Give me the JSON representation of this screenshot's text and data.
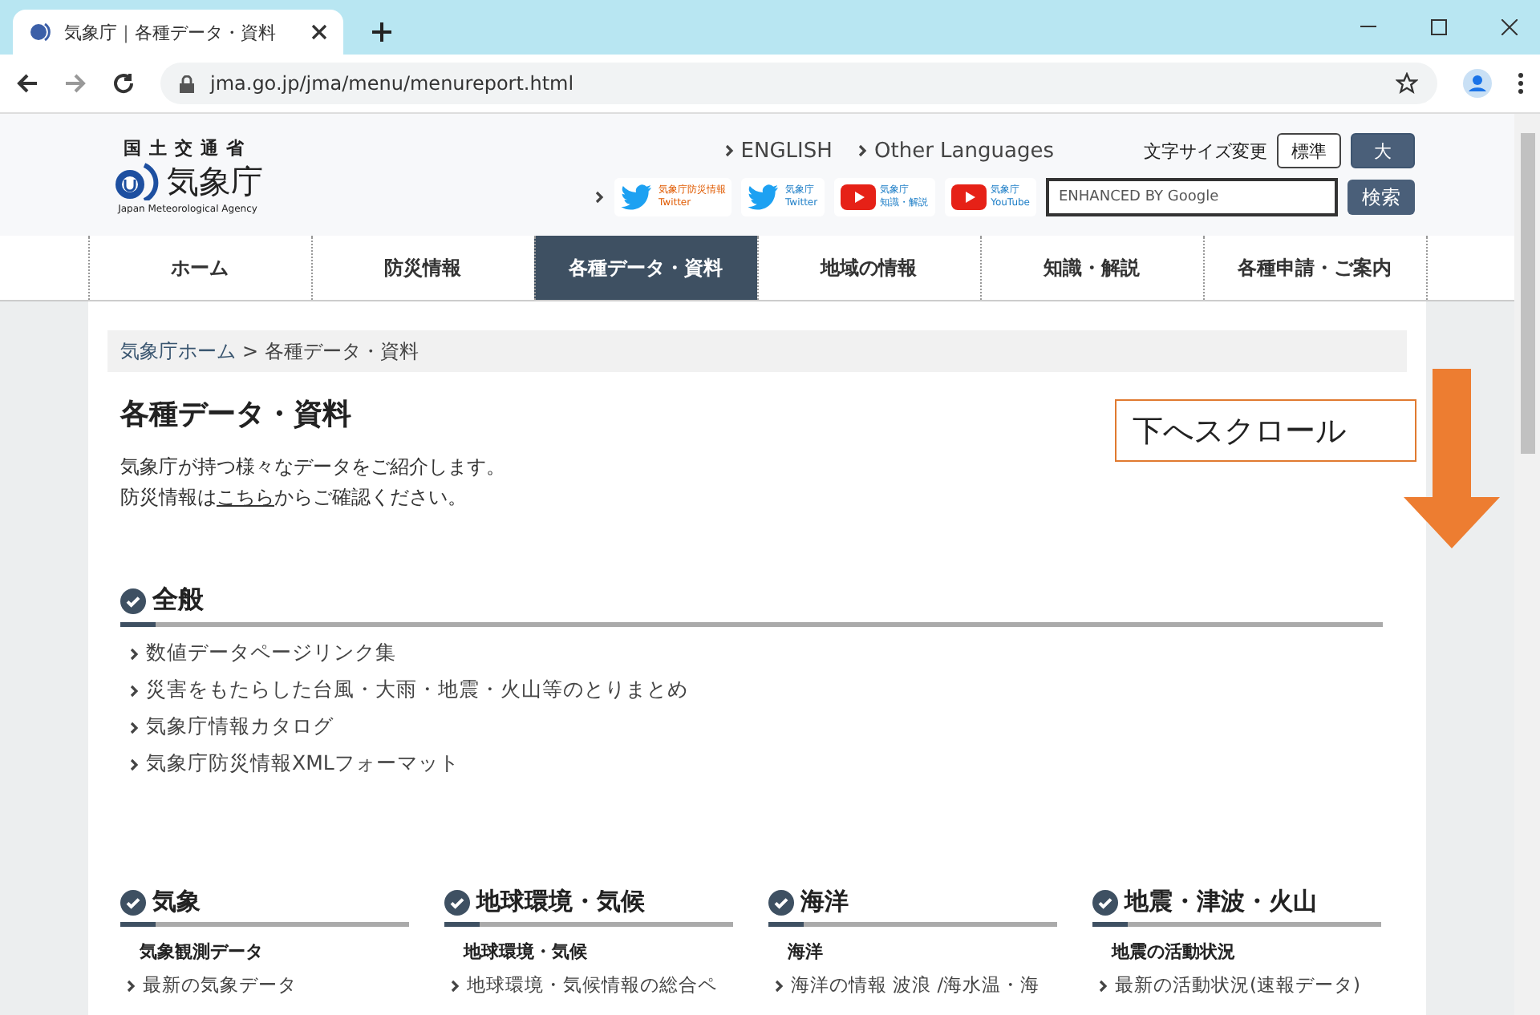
{
  "browser": {
    "tab_title": "気象庁｜各種データ・資料",
    "url": "jma.go.jp/jma/menu/menureport.html"
  },
  "header": {
    "ministry": "国土交通省",
    "logo_text": "気象庁",
    "logo_subtitle": "Japan Meteorological Agency",
    "language_links": [
      "ENGLISH",
      "Other Languages"
    ],
    "font_size_label": "文字サイズ変更",
    "font_size_buttons": [
      {
        "label": "標準",
        "selected": true
      },
      {
        "label": "大",
        "selected": false
      }
    ],
    "social_links": [
      {
        "kind": "twitter",
        "line1": "気象庁防災情報",
        "line2": "Twitter"
      },
      {
        "kind": "twitter",
        "line1": "気象庁",
        "line2": "Twitter"
      },
      {
        "kind": "youtube",
        "line1": "気象庁",
        "line2": "知識・解説"
      },
      {
        "kind": "youtube",
        "line1": "気象庁",
        "line2": "YouTube"
      }
    ],
    "search": {
      "placeholder": "ENHANCED BY Google",
      "button": "検索"
    }
  },
  "nav": [
    {
      "label": "ホーム",
      "selected": false
    },
    {
      "label": "防災情報",
      "selected": false
    },
    {
      "label": "各種データ・資料",
      "selected": true
    },
    {
      "label": "地域の情報",
      "selected": false
    },
    {
      "label": "知識・解説",
      "selected": false
    },
    {
      "label": "各種申請・ご案内",
      "selected": false
    }
  ],
  "breadcrumb_separator": ">",
  "breadcrumb": [
    {
      "label": "気象庁ホーム",
      "kind": "link"
    },
    {
      "label": "各種データ・資料",
      "kind": "current"
    }
  ],
  "page": {
    "title": "各種データ・資料",
    "intro": "気象庁が持つ様々なデータをご紹介します。",
    "intro2_before": "防災情報は",
    "intro2_link": "こちら",
    "intro2_after": "からご確認ください。"
  },
  "annotation": {
    "text": "下へスクロール"
  },
  "general": {
    "title": "全般",
    "links": [
      "数値データページリンク集",
      "災害をもたらした台風・大雨・地震・火山等のとりまとめ",
      "気象庁情報カタログ",
      "気象庁防災情報XMLフォーマット"
    ]
  },
  "columns": [
    {
      "title": "気象",
      "subheading": "気象観測データ",
      "links": [
        "最新の気象データ"
      ]
    },
    {
      "title": "地球環境・気候",
      "subheading": "地球環境・気候",
      "links": [
        "地球環境・気候情報の総合ペ"
      ]
    },
    {
      "title": "海洋",
      "subheading": "海洋",
      "links": [
        "海洋の情報 波浪 /海水温・海"
      ]
    },
    {
      "title": "地震・津波・火山",
      "subheading": "地震の活動状況",
      "links": [
        "最新の活動状況(速報データ)"
      ]
    }
  ]
}
